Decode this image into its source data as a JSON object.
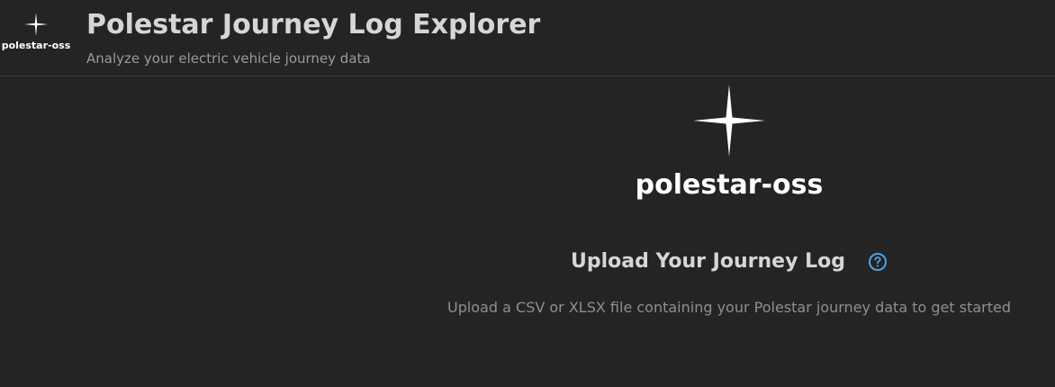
{
  "header": {
    "logo_text": "polestar-oss",
    "title": "Polestar Journey Log Explorer",
    "subtitle": "Analyze your electric vehicle journey data"
  },
  "main": {
    "logo_text": "polestar-oss",
    "upload_title": "Upload Your Journey Log",
    "upload_description": "Upload a CSV or XLSX file containing your Polestar journey data to get started"
  },
  "icons": {
    "logo": "polestar-star-icon",
    "help": "help-circle-icon"
  },
  "colors": {
    "background": "#242424",
    "title": "#d6d6d6",
    "subtitle": "#9a9a9a",
    "help_icon": "#4da3e6"
  }
}
